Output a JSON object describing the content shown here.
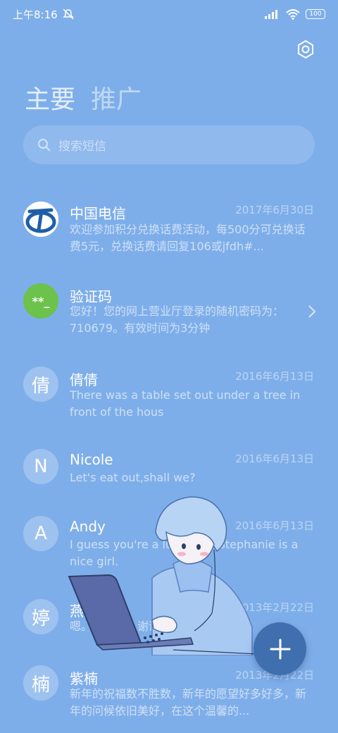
{
  "status_bar": {
    "time": "上午8:16",
    "battery": "100",
    "icons": [
      "mute-icon",
      "signal-icon",
      "wifi-icon",
      "battery-icon"
    ]
  },
  "header": {
    "settings_icon": "settings-icon",
    "tabs": [
      {
        "label": "主要",
        "active": true
      },
      {
        "label": "推广",
        "active": false
      }
    ]
  },
  "search": {
    "placeholder": "搜索短信",
    "icon": "search-icon"
  },
  "conversations": [
    {
      "avatar_text": "",
      "avatar_type": "china-telecom-logo",
      "name": "中国电信",
      "date": "2017年6月30日",
      "preview": "欢迎参加积分兑换话费活动，每500分可兑换话费5元，兑换话费请回复106或jfdh#..."
    },
    {
      "avatar_text": "**_",
      "avatar_type": "verification-code",
      "name": "验证码",
      "date": "",
      "preview": "您好！您的网上营业厅登录的随机密码为：710679。有效时间为3分钟"
    },
    {
      "avatar_text": "倩",
      "avatar_type": "letter",
      "name": "倩倩",
      "date": "2016年6月13日",
      "preview": "There was a table set out under a tree in front of the hous"
    },
    {
      "avatar_text": "N",
      "avatar_type": "letter",
      "name": "Nicole",
      "date": "2016年6月13日",
      "preview": "Let's eat out,shall we?"
    },
    {
      "avatar_text": "A",
      "avatar_type": "letter",
      "name": "Andy",
      "date": "2016年6月13日",
      "preview": "I guess you're a lucky guy.Stephanie is a nice girl."
    },
    {
      "avatar_text": "婷",
      "avatar_type": "letter",
      "name": "燕婷",
      "date": "2013年2月22日",
      "preview": "嗯。收到啦。谢谢啦。"
    },
    {
      "avatar_text": "楠",
      "avatar_type": "letter",
      "name": "紫楠",
      "date": "2013年2月22日",
      "preview": "新年的祝福数不胜数，新年的愿望好多好多，新年的问候依旧美好，在这个温馨的..."
    }
  ],
  "fab": {
    "icon": "plus-icon"
  },
  "colors": {
    "background": "#7eaeea",
    "fab": "#3f6fae",
    "verification_avatar": "#6cc24a",
    "telecom_blue": "#1f5faa"
  }
}
